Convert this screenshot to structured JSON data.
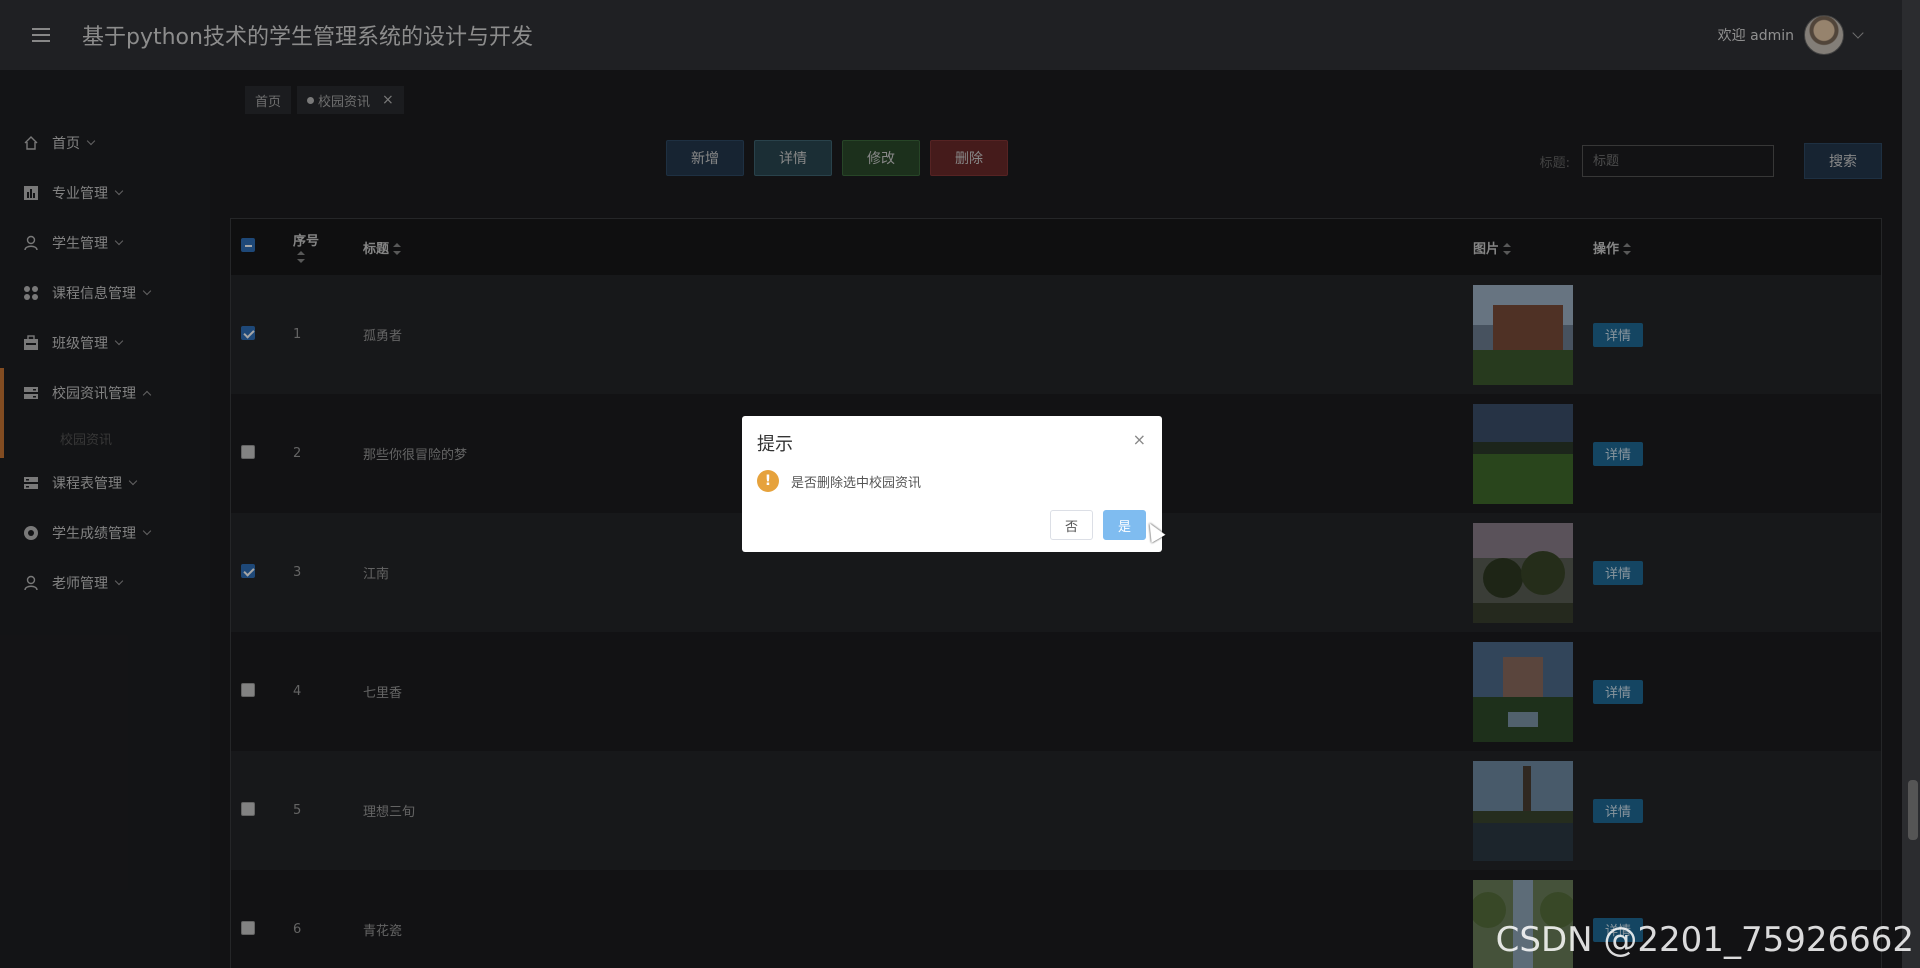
{
  "header": {
    "title": "基于python技术的学生管理系统的设计与开发",
    "welcome": "欢迎 admin"
  },
  "sidebar": {
    "items": [
      {
        "label": "首页",
        "icon": "home-icon"
      },
      {
        "label": "专业管理",
        "icon": "chart-icon"
      },
      {
        "label": "学生管理",
        "icon": "user-icon"
      },
      {
        "label": "课程信息管理",
        "icon": "grid-icon"
      },
      {
        "label": "班级管理",
        "icon": "building-icon"
      },
      {
        "label": "校园资讯管理",
        "icon": "news-icon"
      },
      {
        "label": "课程表管理",
        "icon": "table-icon"
      },
      {
        "label": "学生成绩管理",
        "icon": "score-icon"
      },
      {
        "label": "老师管理",
        "icon": "teacher-icon"
      }
    ],
    "sub_item": "校园资讯",
    "accent": "#c87533"
  },
  "tabs": {
    "home": "首页",
    "current": "校园资讯",
    "close": "×"
  },
  "toolbar": {
    "add": "新增",
    "detail": "详情",
    "edit": "修改",
    "delete": "删除"
  },
  "search": {
    "label": "标题:",
    "placeholder": "标题",
    "button": "搜索"
  },
  "table": {
    "headers": {
      "index": "序号",
      "title": "标题",
      "image": "图片",
      "action": "操作"
    },
    "rows": [
      {
        "index": "1",
        "title": "孤勇者",
        "checked": true,
        "action": "详情"
      },
      {
        "index": "2",
        "title": "那些你很冒险的梦",
        "checked": false,
        "action": "详情"
      },
      {
        "index": "3",
        "title": "江南",
        "checked": true,
        "action": "详情"
      },
      {
        "index": "4",
        "title": "七里香",
        "checked": false,
        "action": "详情"
      },
      {
        "index": "5",
        "title": "理想三旬",
        "checked": false,
        "action": "详情"
      },
      {
        "index": "6",
        "title": "青花瓷",
        "checked": false,
        "action": "详情"
      }
    ]
  },
  "dialog": {
    "title": "提示",
    "message": "是否删除选中校园资讯",
    "no": "否",
    "yes": "是",
    "close": "×",
    "warn": "!"
  },
  "watermark": "CSDN @2201_75926662"
}
